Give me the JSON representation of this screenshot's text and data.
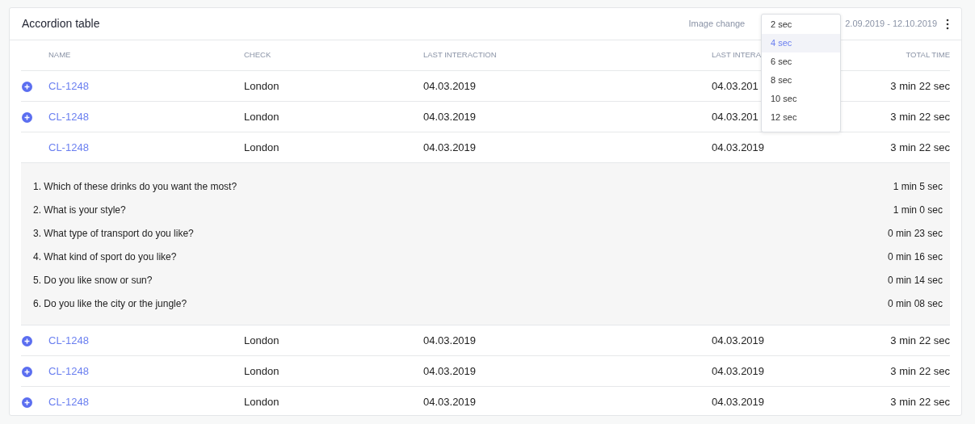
{
  "card": {
    "title": "Accordion table",
    "image_change_label": "Image change",
    "date_range": "2.09.2019 - 12.10.2019"
  },
  "dropdown": {
    "options": [
      {
        "label": "2 sec",
        "selected": false
      },
      {
        "label": "4 sec",
        "selected": true
      },
      {
        "label": "6 sec",
        "selected": false
      },
      {
        "label": "8 sec",
        "selected": false
      },
      {
        "label": "10 sec",
        "selected": false
      },
      {
        "label": "12 sec",
        "selected": false
      }
    ]
  },
  "table": {
    "columns": [
      "NAME",
      "CHECK",
      "LAST INTERACTION",
      "LAST INTERA",
      "TOTAL TIME"
    ],
    "rows": [
      {
        "name": "CL-1248",
        "check": "London",
        "last_interaction": "04.03.2019",
        "last_interaction_2": "04.03.201",
        "total_time": "3 min 22 sec",
        "expanded": false
      },
      {
        "name": "CL-1248",
        "check": "London",
        "last_interaction": "04.03.2019",
        "last_interaction_2": "04.03.201",
        "total_time": "3 min 22 sec",
        "expanded": false
      },
      {
        "name": "CL-1248",
        "check": "London",
        "last_interaction": "04.03.2019",
        "last_interaction_2": "04.03.2019",
        "total_time": "3 min 22 sec",
        "expanded": true,
        "details": [
          {
            "question": "1. Which of these drinks do you want the most?",
            "time": "1 min 5 sec"
          },
          {
            "question": "2. What is your style?",
            "time": "1 min 0 sec"
          },
          {
            "question": "3. What type of transport do you like?",
            "time": "0 min 23 sec"
          },
          {
            "question": "4. What kind of sport do you like?",
            "time": "0 min 16 sec"
          },
          {
            "question": "5. Do you like snow or sun?",
            "time": "0 min 14 sec"
          },
          {
            "question": "6. Do you like the city or the jungle?",
            "time": "0 min 08 sec"
          }
        ]
      },
      {
        "name": "CL-1248",
        "check": "London",
        "last_interaction": "04.03.2019",
        "last_interaction_2": "04.03.2019",
        "total_time": "3 min 22 sec",
        "expanded": false
      },
      {
        "name": "CL-1248",
        "check": "London",
        "last_interaction": "04.03.2019",
        "last_interaction_2": "04.03.2019",
        "total_time": "3 min 22 sec",
        "expanded": false
      },
      {
        "name": "CL-1248",
        "check": "London",
        "last_interaction": "04.03.2019",
        "last_interaction_2": "04.03.2019",
        "total_time": "3 min 22 sec",
        "expanded": false
      }
    ]
  }
}
